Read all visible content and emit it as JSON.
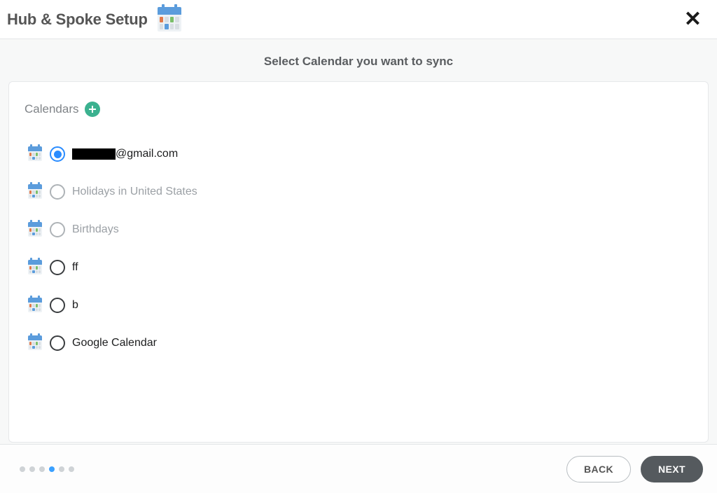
{
  "header": {
    "title": "Hub & Spoke Setup"
  },
  "subtitle": "Select Calendar you want to sync",
  "section": {
    "title": "Calendars"
  },
  "calendars": [
    {
      "label_suffix": "@gmail.com",
      "redacted_prefix": true,
      "selected": true,
      "disabled": false
    },
    {
      "label": "Holidays in United States",
      "selected": false,
      "disabled": true
    },
    {
      "label": "Birthdays",
      "selected": false,
      "disabled": true
    },
    {
      "label": "ff",
      "selected": false,
      "disabled": false
    },
    {
      "label": "b",
      "selected": false,
      "disabled": false
    },
    {
      "label": "Google Calendar",
      "selected": false,
      "disabled": false
    }
  ],
  "progress": {
    "total": 6,
    "active_index": 3
  },
  "buttons": {
    "back": "BACK",
    "next": "NEXT"
  }
}
